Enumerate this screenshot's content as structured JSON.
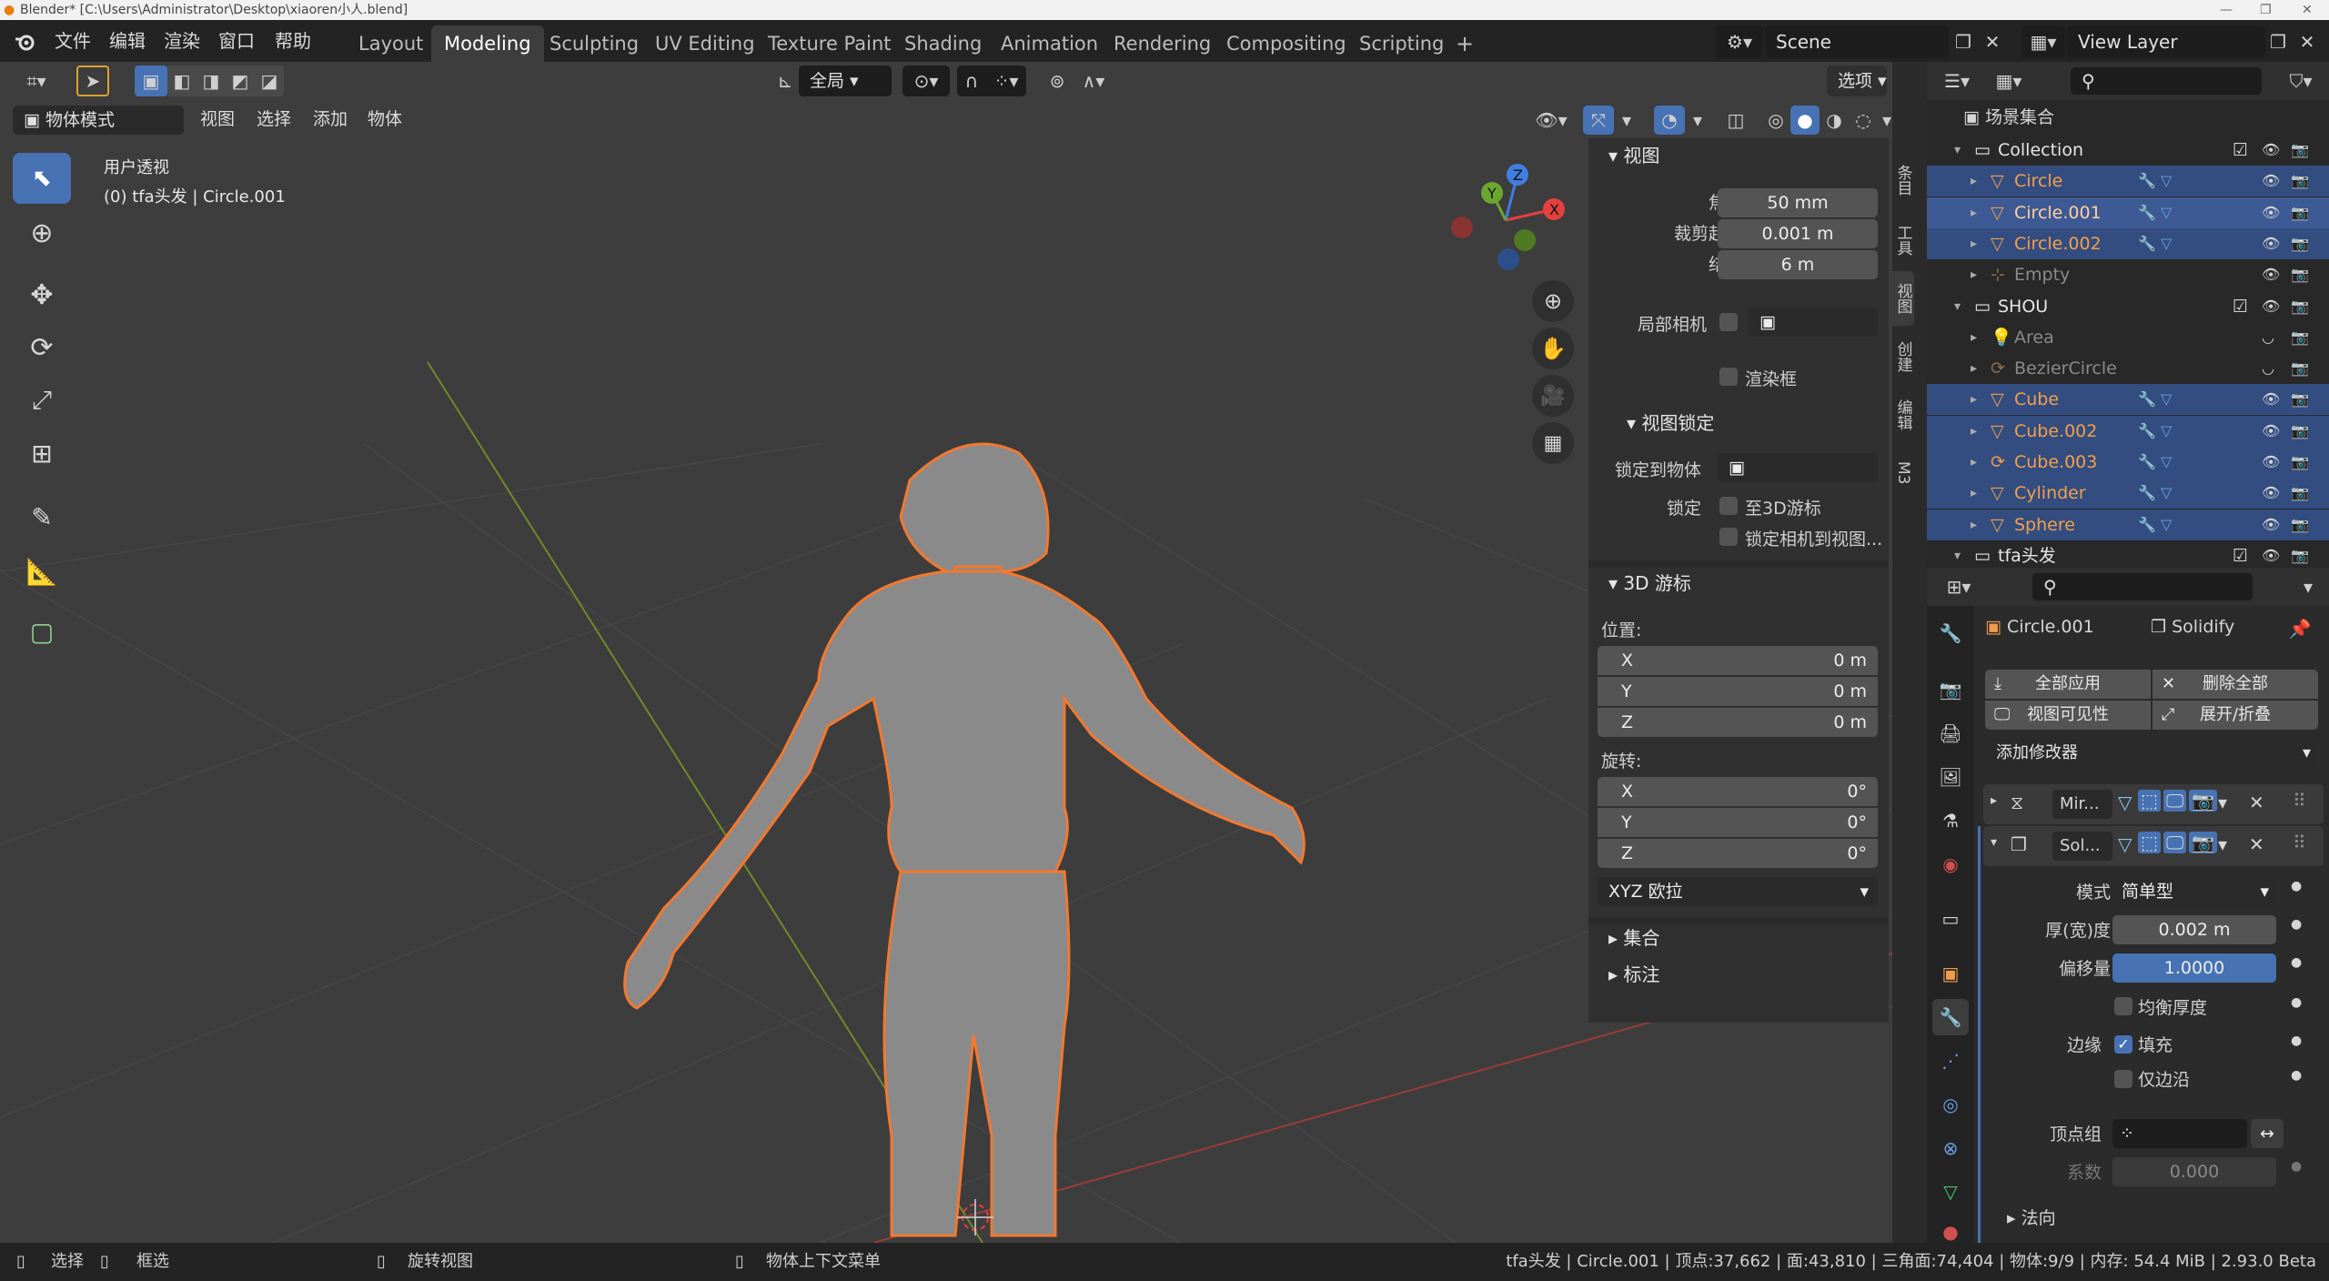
{
  "titlebar": {
    "text": "Blender* [C:\\Users\\Administrator\\Desktop\\xiaoren小人.blend]"
  },
  "menu": {
    "file": "文件",
    "edit": "编辑",
    "render": "渲染",
    "window": "窗口",
    "help": "帮助"
  },
  "workspaces": [
    "Layout",
    "Modeling",
    "Sculpting",
    "UV Editing",
    "Texture Paint",
    "Shading",
    "Animation",
    "Rendering",
    "Compositing",
    "Scripting"
  ],
  "workspace_add": "+",
  "scene": {
    "name": "Scene",
    "view_layer": "View Layer"
  },
  "viewport_header": {
    "transform_orientation": "全局",
    "options": "选项",
    "mode": "物体模式",
    "menus": [
      "视图",
      "选择",
      "添加",
      "物体"
    ]
  },
  "viewport": {
    "view_name": "用户透视",
    "object_info": "(0) tfa头发 | Circle.001"
  },
  "gizmo": {
    "x": "X",
    "y": "Y",
    "z": "Z"
  },
  "npanel": {
    "view": {
      "title": "视图",
      "focal_length_label": "焦距",
      "focal_length": "50 mm",
      "clip_start_label": "裁剪起点",
      "clip_start": "0.001 m",
      "clip_end_label": "结束",
      "clip_end": "6 m",
      "local_camera_label": "局部相机",
      "render_border_label": "渲染框",
      "view_lock_title": "视图锁定",
      "lock_to_object_label": "锁定到物体",
      "lock_label": "锁定",
      "lock_3d_cursor": "至3D游标",
      "lock_camera": "锁定相机到视图..."
    },
    "cursor": {
      "title": "3D 游标",
      "location_label": "位置:",
      "loc": [
        {
          "axis": "X",
          "value": "0 m"
        },
        {
          "axis": "Y",
          "value": "0 m"
        },
        {
          "axis": "Z",
          "value": "0 m"
        }
      ],
      "rotation_label": "旋转:",
      "rot": [
        {
          "axis": "X",
          "value": "0°"
        },
        {
          "axis": "Y",
          "value": "0°"
        },
        {
          "axis": "Z",
          "value": "0°"
        }
      ],
      "rotation_mode": "XYZ 欧拉"
    },
    "collection_title": "集合",
    "annotation_title": "标注",
    "tabs": [
      "条目",
      "工具",
      "视图",
      "创建",
      "编辑",
      "M3"
    ]
  },
  "outliner": {
    "scene_collection": "场景集合",
    "rows": [
      {
        "name": "Collection",
        "kind": "collection"
      },
      {
        "name": "Circle",
        "kind": "mesh"
      },
      {
        "name": "Circle.001",
        "kind": "mesh"
      },
      {
        "name": "Circle.002",
        "kind": "mesh"
      },
      {
        "name": "Empty",
        "kind": "empty"
      },
      {
        "name": "SHOU",
        "kind": "collection"
      },
      {
        "name": "Area",
        "kind": "light"
      },
      {
        "name": "BezierCircle",
        "kind": "curve"
      },
      {
        "name": "Cube",
        "kind": "mesh"
      },
      {
        "name": "Cube.002",
        "kind": "mesh"
      },
      {
        "name": "Cube.003",
        "kind": "curve"
      },
      {
        "name": "Cylinder",
        "kind": "mesh"
      },
      {
        "name": "Sphere",
        "kind": "mesh"
      },
      {
        "name": "tfa头发",
        "kind": "collection"
      }
    ]
  },
  "properties": {
    "object_name": "Circle.001",
    "modifier_name": "Solidify",
    "apply_all": "全部应用",
    "delete_all": "删除全部",
    "viewport_vis": "视图可见性",
    "expand_collapse": "展开/折叠",
    "add_modifier": "添加修改器",
    "mod1_name": "Mir...",
    "mod2_name": "Sol...",
    "mode_label": "模式",
    "mode_value": "简单型",
    "thickness_label": "厚(宽)度",
    "thickness_value": "0.002 m",
    "offset_label": "偏移量",
    "offset_value": "1.0000",
    "even_thickness": "均衡厚度",
    "rim_label": "边缘",
    "rim_fill": "填充",
    "rim_only": "仅边沿",
    "vgroup_label": "顶点组",
    "factor_label": "系数",
    "factor_value": "0.000",
    "normals": "法向"
  },
  "statusbar": {
    "select": "选择",
    "box_select": "框选",
    "rotate_view": "旋转视图",
    "context_menu": "物体上下文菜单",
    "stats": "tfa头发 | Circle.001 | 顶点:37,662 | 面:43,810 | 三角面:74,404 | 物体:9/9 | 内存: 54.4 MiB | 2.93.0 Beta"
  },
  "colors": {
    "accent": "#4772b3",
    "selection": "#f3782f",
    "mesh_icon": "#f09c4f"
  }
}
